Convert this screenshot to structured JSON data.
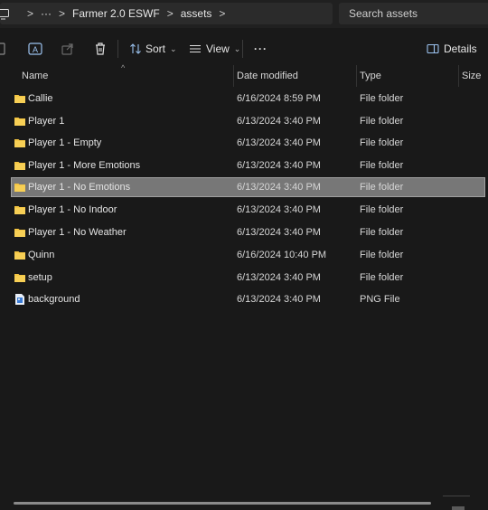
{
  "breadcrumb": {
    "overflow": "···",
    "items": [
      "Farmer 2.0 ESWF",
      "assets"
    ],
    "separator": ">"
  },
  "search": {
    "placeholder": "Search assets",
    "value": ""
  },
  "toolbar": {
    "sort_label": "Sort",
    "view_label": "View",
    "more_label": "···",
    "details_label": "Details",
    "sort_chevron": "⌄",
    "view_chevron": "⌄"
  },
  "columns": {
    "name": "Name",
    "date": "Date modified",
    "type": "Type",
    "size": "Size",
    "sort_caret": "^"
  },
  "files": [
    {
      "name": "Callie",
      "date": "6/16/2024 8:59 PM",
      "type": "File folder",
      "icon": "folder-icon",
      "selected": false
    },
    {
      "name": "Player 1",
      "date": "6/13/2024 3:40 PM",
      "type": "File folder",
      "icon": "folder-icon",
      "selected": false
    },
    {
      "name": "Player 1 - Empty",
      "date": "6/13/2024 3:40 PM",
      "type": "File folder",
      "icon": "folder-icon",
      "selected": false
    },
    {
      "name": "Player 1 - More Emotions",
      "date": "6/13/2024 3:40 PM",
      "type": "File folder",
      "icon": "folder-icon",
      "selected": false
    },
    {
      "name": "Player 1 - No Emotions",
      "date": "6/13/2024 3:40 PM",
      "type": "File folder",
      "icon": "folder-icon",
      "selected": true
    },
    {
      "name": "Player 1 - No Indoor",
      "date": "6/13/2024 3:40 PM",
      "type": "File folder",
      "icon": "folder-icon",
      "selected": false
    },
    {
      "name": "Player 1 - No Weather",
      "date": "6/13/2024 3:40 PM",
      "type": "File folder",
      "icon": "folder-icon",
      "selected": false
    },
    {
      "name": "Quinn",
      "date": "6/16/2024 10:40 PM",
      "type": "File folder",
      "icon": "folder-icon",
      "selected": false
    },
    {
      "name": "setup",
      "date": "6/13/2024 3:40 PM",
      "type": "File folder",
      "icon": "folder-icon",
      "selected": false
    },
    {
      "name": "background",
      "date": "6/13/2024 3:40 PM",
      "type": "PNG File",
      "icon": "png-file-icon",
      "selected": false
    }
  ],
  "colors": {
    "folder": "#f4c542",
    "selection": "#777777",
    "background": "#191919"
  }
}
